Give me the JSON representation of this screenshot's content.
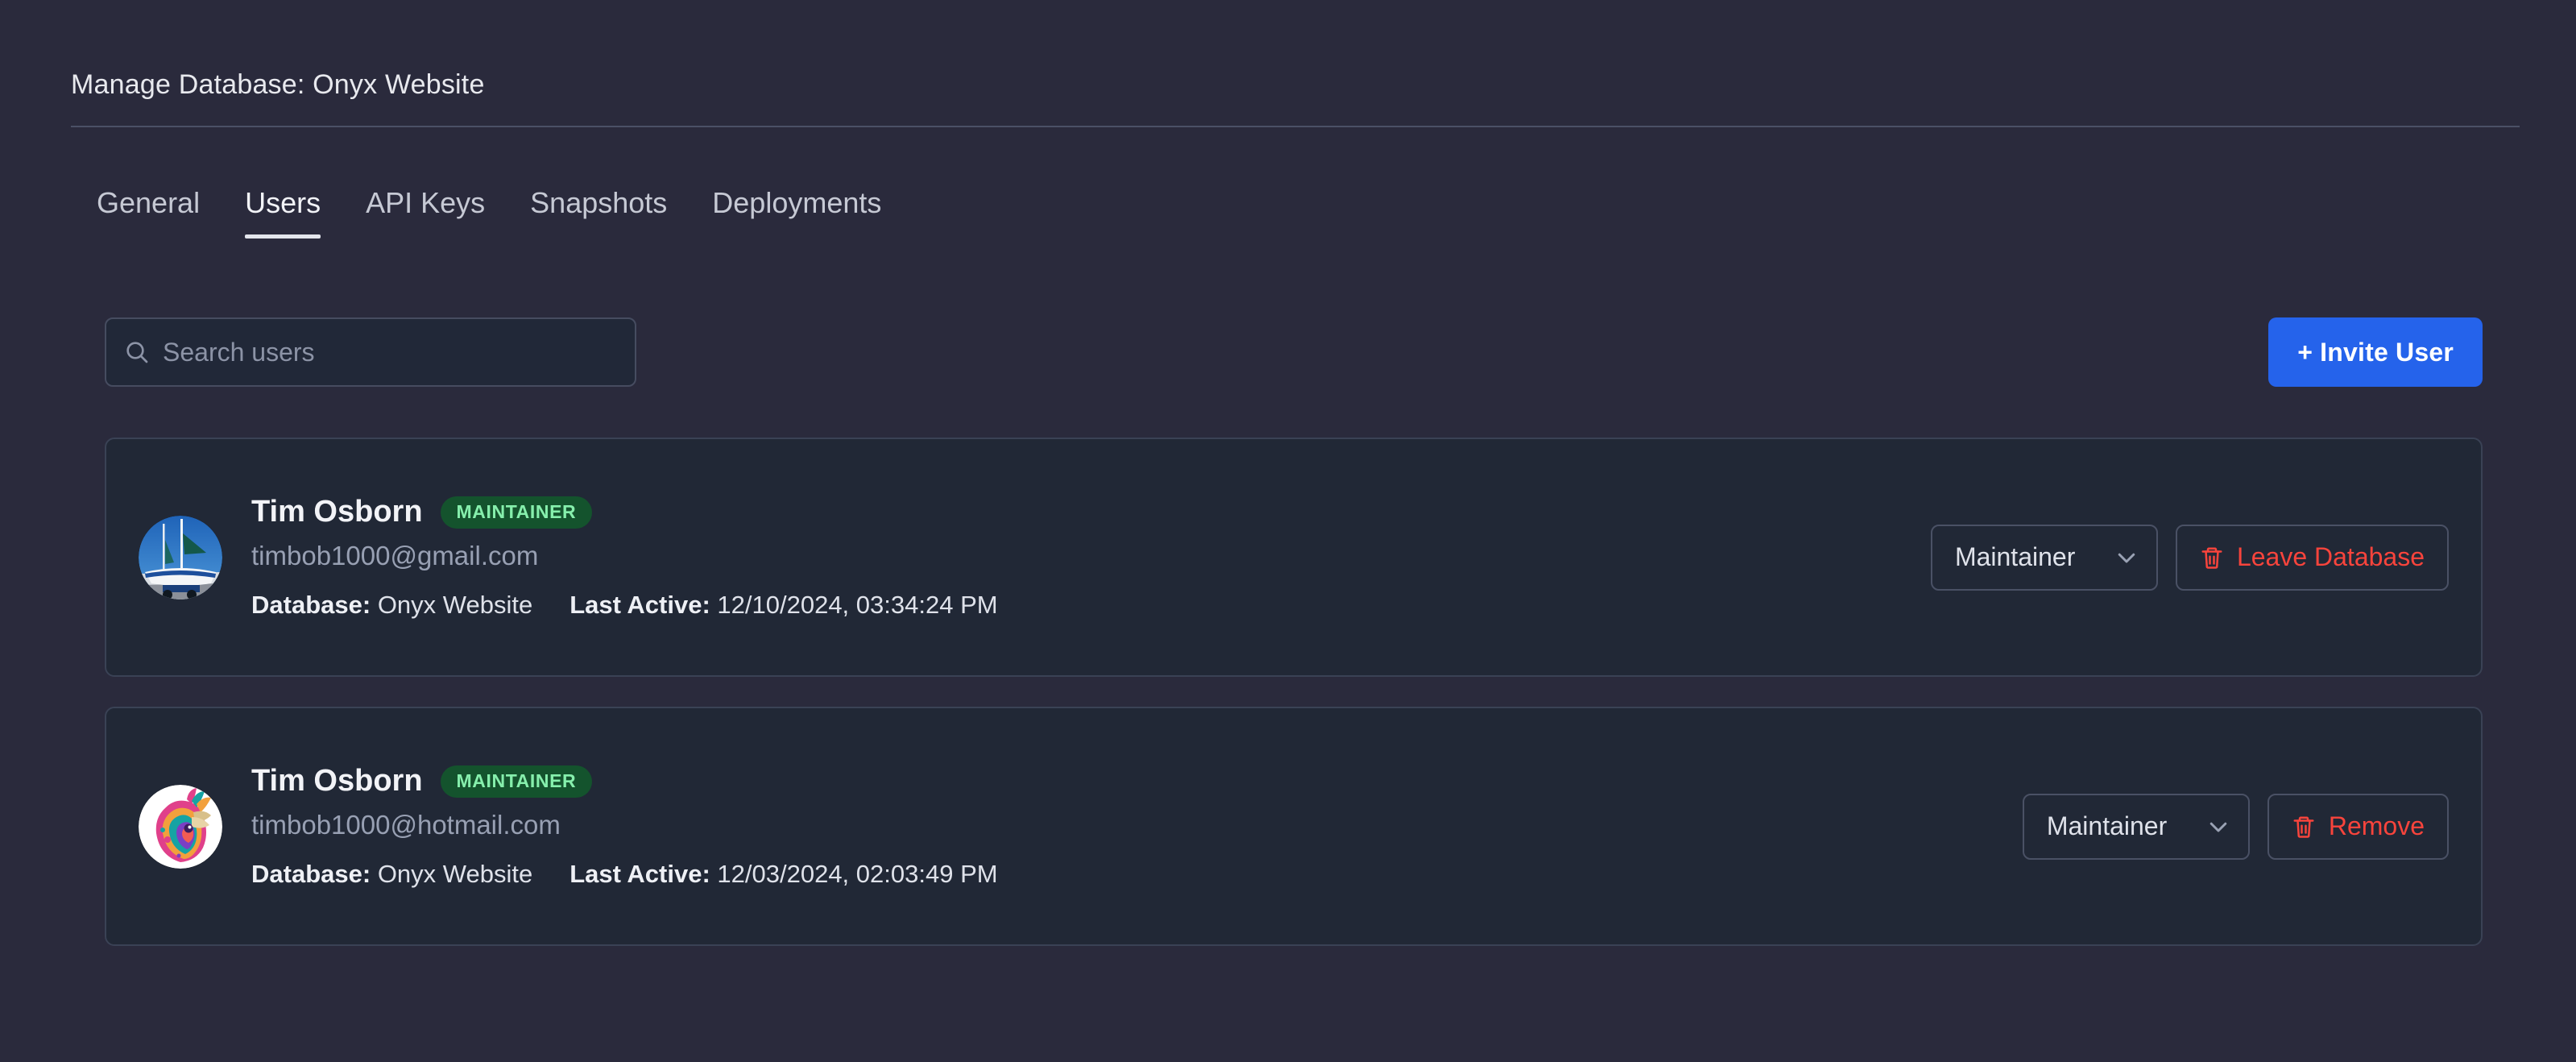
{
  "header": {
    "title": "Manage Database: Onyx Website"
  },
  "tabs": [
    {
      "label": "General",
      "active": false
    },
    {
      "label": "Users",
      "active": true
    },
    {
      "label": "API Keys",
      "active": false
    },
    {
      "label": "Snapshots",
      "active": false
    },
    {
      "label": "Deployments",
      "active": false
    }
  ],
  "toolbar": {
    "search_placeholder": "Search users",
    "search_value": "",
    "invite_label": "+ Invite User",
    "invite_color": "#2563eb"
  },
  "labels": {
    "database_label": "Database:",
    "last_active_label": "Last Active:"
  },
  "colors": {
    "page_background": "#2a2a3c",
    "card_background": "#212836",
    "badge_background": "#14532d",
    "badge_text": "#86efac",
    "danger": "#f8443c",
    "accent": "#2563eb"
  },
  "users": [
    {
      "name": "Tim Osborn",
      "badge": "MAINTAINER",
      "email": "timbob1000@gmail.com",
      "database": "Onyx Website",
      "last_active": "12/10/2024, 03:34:24 PM",
      "role_value": "Maintainer",
      "action_label": "Leave Database",
      "avatar_alt": "sailboat-photo-avatar"
    },
    {
      "name": "Tim Osborn",
      "badge": "MAINTAINER",
      "email": "timbob1000@hotmail.com",
      "database": "Onyx Website",
      "last_active": "12/03/2024, 02:03:49 PM",
      "role_value": "Maintainer",
      "action_label": "Remove",
      "avatar_alt": "colorful-llama-illustration-avatar"
    }
  ]
}
